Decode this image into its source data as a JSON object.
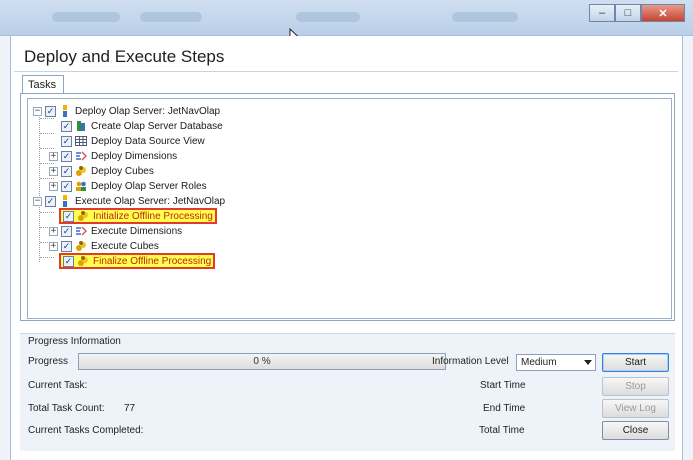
{
  "window": {
    "title": "Deploy and Execute Steps",
    "controls": {
      "minimize": "–",
      "maximize": "□",
      "close": "✕"
    }
  },
  "tabs": [
    {
      "label": "Tasks"
    }
  ],
  "tree": [
    {
      "label": "Deploy Olap Server: JetNavOlap",
      "level": 0,
      "expander": "⊟",
      "checked": true,
      "icon": "olap-server-icon",
      "highlighted": false
    },
    {
      "label": "Create Olap Server Database",
      "level": 1,
      "expander": "",
      "checked": true,
      "icon": "database-icon",
      "highlighted": false
    },
    {
      "label": "Deploy Data Source View",
      "level": 1,
      "expander": "",
      "checked": true,
      "icon": "table-grid-icon",
      "highlighted": false
    },
    {
      "label": "Deploy Dimensions",
      "level": 1,
      "expander": "⊞",
      "checked": true,
      "icon": "dimension-icon",
      "highlighted": false
    },
    {
      "label": "Deploy Cubes",
      "level": 1,
      "expander": "⊞",
      "checked": true,
      "icon": "cube-icon",
      "highlighted": false
    },
    {
      "label": "Deploy Olap Server Roles",
      "level": 1,
      "expander": "⊞",
      "checked": true,
      "icon": "roles-icon",
      "highlighted": false
    },
    {
      "label": "Execute Olap Server: JetNavOlap",
      "level": 0,
      "expander": "⊟",
      "checked": true,
      "icon": "olap-server-icon",
      "highlighted": false
    },
    {
      "label": "Initialize Offline Processing",
      "level": 1,
      "expander": "",
      "checked": true,
      "icon": "cube-icon",
      "highlighted": true
    },
    {
      "label": "Execute Dimensions",
      "level": 1,
      "expander": "⊞",
      "checked": true,
      "icon": "dimension-icon",
      "highlighted": false
    },
    {
      "label": "Execute Cubes",
      "level": 1,
      "expander": "⊞",
      "checked": true,
      "icon": "cube-icon",
      "highlighted": false
    },
    {
      "label": "Finalize Offline Processing",
      "level": 1,
      "expander": "",
      "checked": true,
      "icon": "cube-icon",
      "highlighted": true
    }
  ],
  "progress": {
    "section_title": "Progress Information",
    "label": "Progress",
    "percent": 0,
    "percent_text": "0 %",
    "info_level_label": "Information Level",
    "info_level_value": "Medium",
    "current_task_label": "Current Task:",
    "total_task_count_label": "Total Task Count:",
    "total_task_count_value": "77",
    "tasks_completed_label": "Current Tasks Completed:",
    "start_time_label": "Start Time",
    "end_time_label": "End Time",
    "total_time_label": "Total Time"
  },
  "buttons": {
    "start": "Start",
    "stop": "Stop",
    "view_log": "View Log",
    "close": "Close"
  },
  "colors": {
    "highlight_fill": "#ffff4d",
    "highlight_border": "#e23a2c",
    "highlight_text": "#c02418",
    "progress_fill": "#45b34a"
  }
}
